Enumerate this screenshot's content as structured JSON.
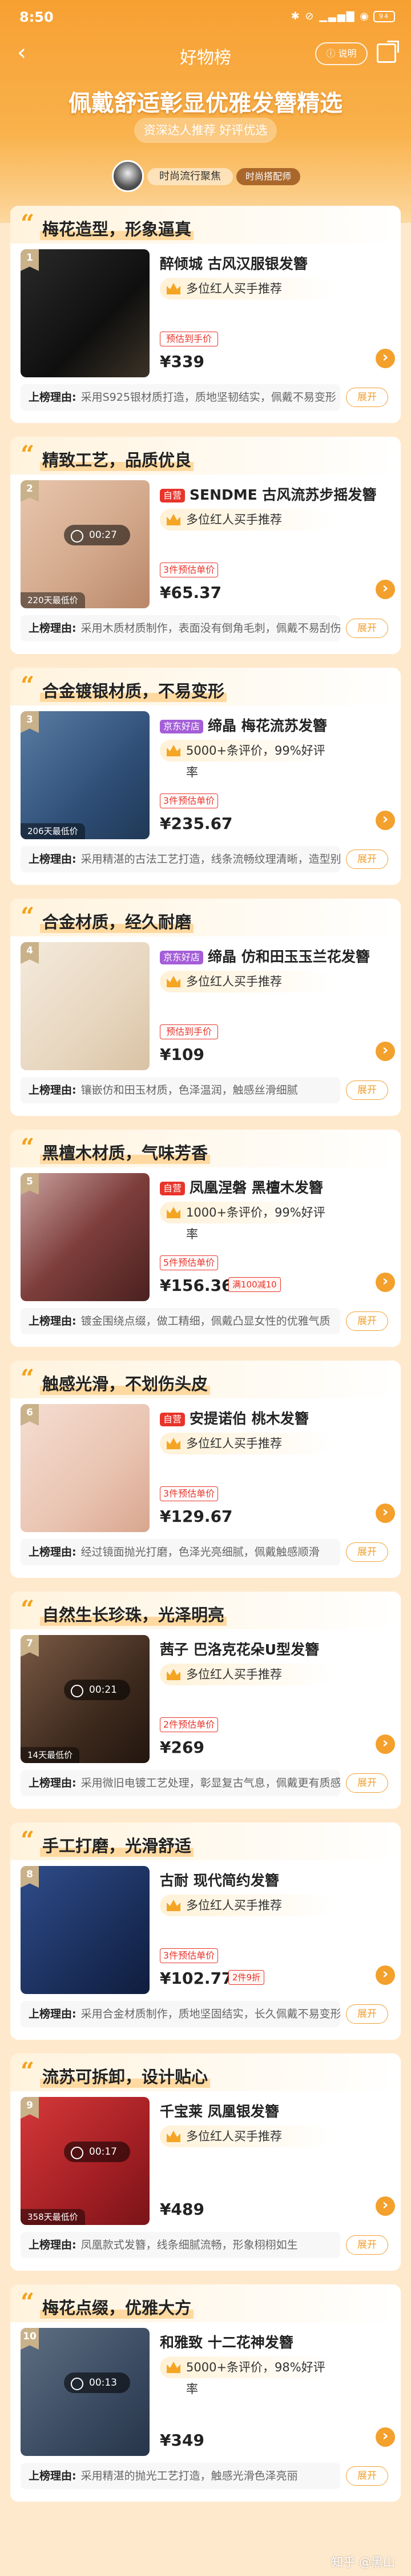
{
  "status_bar": {
    "time": "8:50",
    "right_icons": "✱ ⊘ ▁▃▅▇ ◉",
    "battery": "94"
  },
  "nav": {
    "title": "好物榜",
    "rules": "ⓘ 说明",
    "back_icon": "chevron-left-icon",
    "share_icon": "share-icon"
  },
  "banner": {
    "title": "佩戴舒适彰显优雅发簪精选",
    "subtitle": "资深达人推荐 好评优选",
    "source_name": "时尚流行聚焦",
    "source_tag": "时尚搭配师"
  },
  "items": [
    {
      "rank": "1",
      "headline": "梅花造型，形象逼真",
      "badge": "",
      "title": "醉倾城 古风汉服银发簪",
      "rec": "多位红人买手推荐",
      "price_tag": "预估到手价",
      "price": "¥339",
      "coupon": "",
      "play": "",
      "play_time": "",
      "reason": "采用S925银材质打造，质地坚韧结实，佩戴不易变形",
      "theme": "dark"
    },
    {
      "rank": "2",
      "headline": "精致工艺，品质优良",
      "badge": "自营",
      "title": "SENDME 古风流苏步摇发簪",
      "rec": "多位红人买手推荐",
      "price_tag": "3件预估单价",
      "price": "¥65.37",
      "coupon": "",
      "play": "▶",
      "play_time": "00:27",
      "play_count": "220天最低价",
      "reason": "采用木质材质制作，表面没有倒角毛刺，佩戴不易刮伤头皮",
      "theme": "wood"
    },
    {
      "rank": "3",
      "headline": "合金镀银材质，不易变形",
      "badge": "京东好店",
      "title": "缔晶 梅花流苏发簪",
      "rec": "5000+条评价，99%好评率",
      "price_tag": "3件预估单价",
      "price": "¥235.67",
      "coupon": "",
      "play": "",
      "play_time": "",
      "play_count": "206天最低价",
      "reason": "采用精湛的古法工艺打造，线条流畅纹理清晰，造型别致",
      "theme": "blue"
    },
    {
      "rank": "4",
      "headline": "合金材质，经久耐磨",
      "badge": "京东好店",
      "title": "缔晶 仿和田玉玉兰花发簪",
      "rec": "多位红人买手推荐",
      "price_tag": "预估到手价",
      "price": "¥109",
      "coupon": "",
      "play": "",
      "play_time": "",
      "play_count": "",
      "reason": "镶嵌仿和田玉材质，色泽温润，触感丝滑细腻",
      "theme": "cream"
    },
    {
      "rank": "5",
      "headline": "黑檀木材质，气味芳香",
      "badge": "自营",
      "title": "凤凰涅磐 黑檀木发簪",
      "rec": "1000+条评价，99%好评率",
      "price_tag": "5件预估单价",
      "price": "¥156.36",
      "coupon": "满100减10",
      "play": "",
      "play_time": "",
      "play_count": "",
      "reason": "镀金围绕点缀，做工精细，佩戴凸显女性的优雅气质",
      "theme": "purple"
    },
    {
      "rank": "6",
      "headline": "触感光滑，不划伤头皮",
      "badge": "自营",
      "title": "安提诺伯 桃木发簪",
      "rec": "多位红人买手推荐",
      "price_tag": "3件预估单价",
      "price": "¥129.67",
      "coupon": "",
      "play": "",
      "play_time": "",
      "play_count": "",
      "reason": "经过镜面抛光打磨，色泽光亮细腻，佩戴触感顺滑",
      "theme": "peach"
    },
    {
      "rank": "7",
      "headline": "自然生长珍珠，光泽明亮",
      "badge": "",
      "title": "茜子 巴洛克花朵U型发簪",
      "rec": "多位红人买手推荐",
      "price_tag": "2件预估单价",
      "price": "¥269",
      "coupon": "",
      "play": "▶",
      "play_time": "00:21",
      "play_count": "14天最低价",
      "reason": "采用微旧电镀工艺处理，彰显复古气息，佩戴更有质感",
      "theme": "brown"
    },
    {
      "rank": "8",
      "headline": "手工打磨，光滑舒适",
      "badge": "",
      "title": "古耐 现代简约发簪",
      "rec": "多位红人买手推荐",
      "price_tag": "3件预估单价",
      "price": "¥102.77",
      "coupon": "2件9折",
      "play": "",
      "play_time": "",
      "play_count": "",
      "reason": "采用合金材质制作，质地坚固结实，长久佩戴不易变形",
      "theme": "navy"
    },
    {
      "rank": "9",
      "headline": "流苏可拆卸，设计贴心",
      "badge": "",
      "title": "千宝莱 凤凰银发簪",
      "rec": "多位红人买手推荐",
      "price_tag": "",
      "price": "¥489",
      "coupon": "",
      "play": "▶",
      "play_time": "00:17",
      "play_count": "358天最低价",
      "reason": "凤凰款式发簪，线条细腻流畅，形象栩栩如生",
      "theme": "red"
    },
    {
      "rank": "10",
      "headline": "梅花点缀，优雅大方",
      "badge": "",
      "title": "和雅致 十二花神发簪",
      "rec": "5000+条评价，98%好评率",
      "price_tag": "",
      "price": "¥349",
      "coupon": "",
      "play": "▶",
      "play_time": "00:13",
      "play_count": "",
      "reason": "采用精湛的抛光工艺打造，触感光滑色泽亮丽",
      "theme": "slate"
    }
  ],
  "labels": {
    "reason_label": "上榜理由:",
    "expand": "展开",
    "arrow": "›"
  },
  "watermark": "知乎 @黑山",
  "colors": {
    "accent": "#f3a02d",
    "price_red": "#e8342a",
    "background": "#ffe9cd"
  }
}
